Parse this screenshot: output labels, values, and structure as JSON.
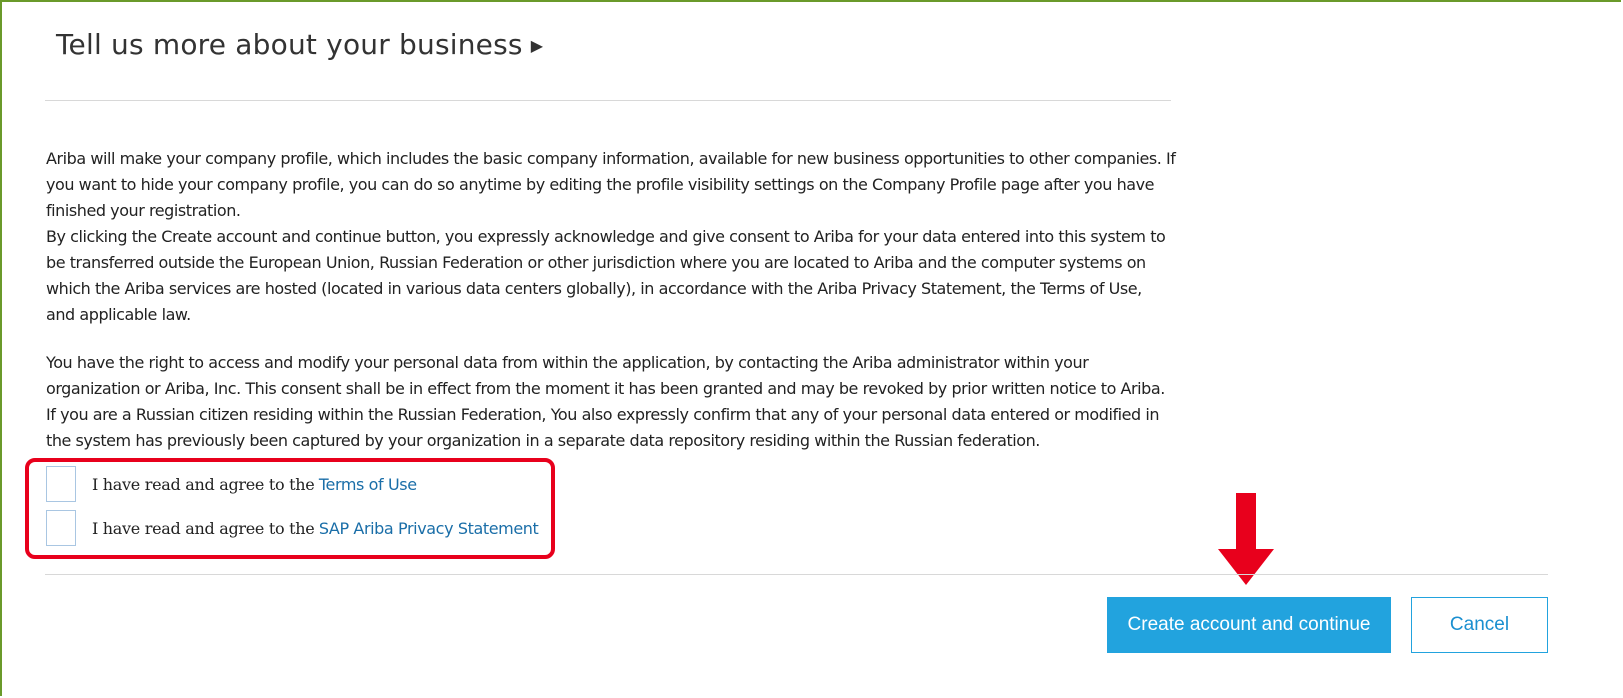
{
  "section": {
    "title": "Tell us more about your business",
    "expand_icon": "triangle-right-icon"
  },
  "consent": {
    "paragraph1_lines": [
      "Ariba will make your company profile, which includes the basic company information, available for new business opportunities to other companies. If",
      "you want to hide your company profile, you can do so anytime by editing the profile visibility settings on the Company Profile page after you have",
      "finished your registration.",
      "By clicking the Create account and continue button, you expressly acknowledge and give consent to Ariba for your data entered into this system to",
      "be transferred outside the European Union, Russian Federation or other jurisdiction where you are located to Ariba and the computer systems on",
      "which the Ariba services are hosted (located in various data centers globally), in accordance with the Ariba Privacy Statement, the Terms of Use,",
      "and applicable law."
    ],
    "paragraph2_lines": [
      "You have the right to access and modify your personal data from within the application, by contacting the Ariba administrator within your",
      "organization or Ariba, Inc. This consent shall be in effect from the moment it has been granted and may be revoked by prior written notice to Ariba.",
      "If you are a Russian citizen residing within the Russian Federation, You also expressly confirm that any of your personal data entered or modified in",
      "the system has previously been captured by your organization in a separate data repository residing within the Russian federation."
    ]
  },
  "agreements": [
    {
      "prefix": "I have read and agree to the ",
      "link": "Terms of Use",
      "checked": false
    },
    {
      "prefix": "I have read and agree to the ",
      "link": "SAP Ariba Privacy Statement",
      "checked": false
    }
  ],
  "actions": {
    "primary_label": "Create account and continue",
    "cancel_label": "Cancel"
  },
  "colors": {
    "primary": "#22a3de",
    "link": "#1a6ea8",
    "annotation": "#e8001c",
    "frame": "#6a9a2a"
  },
  "annotations": {
    "highlight": "red-rounded-rectangle",
    "pointer": "red-down-arrow-icon"
  }
}
